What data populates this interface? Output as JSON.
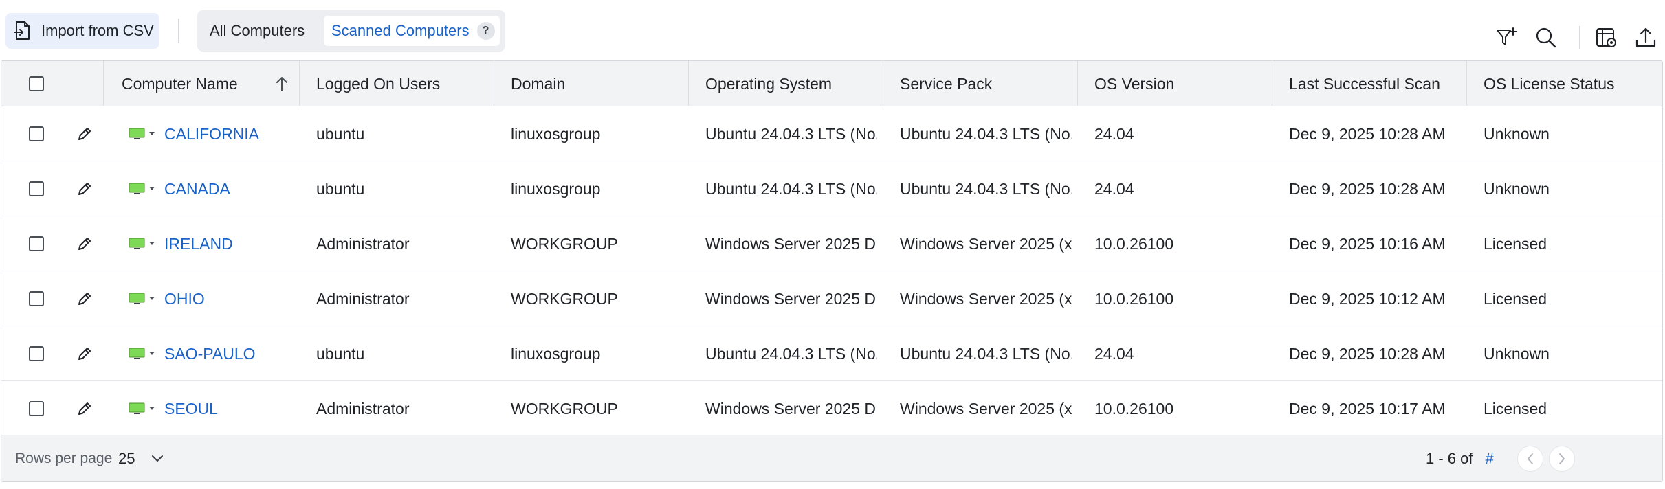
{
  "toolbar": {
    "import_label": "Import from CSV",
    "tabs": [
      {
        "label": "All Computers"
      },
      {
        "label": "Scanned Computers",
        "help": "?"
      }
    ],
    "icons": [
      "filter-add-icon",
      "search-icon",
      "column-settings-icon",
      "export-icon"
    ]
  },
  "colors": {
    "accent": "#1a62c8",
    "computer_icon": "#7ed957",
    "header_bg": "#f2f3f5"
  },
  "table": {
    "headers": [
      "Computer Name",
      "Logged On Users",
      "Domain",
      "Operating System",
      "Service Pack",
      "OS Version",
      "Last Successful Scan",
      "OS License Status"
    ],
    "sort": {
      "column": "Computer Name",
      "direction": "ascending"
    },
    "rows": [
      {
        "name": "CALIFORNIA",
        "user": "ubuntu",
        "domain": "linuxosgroup",
        "os": "Ubuntu 24.04.3 LTS (No...",
        "sp": "Ubuntu 24.04.3 LTS (No...",
        "ver": "24.04",
        "scan": "Dec 9, 2025 10:28 AM",
        "license": "Unknown"
      },
      {
        "name": "CANADA",
        "user": "ubuntu",
        "domain": "linuxosgroup",
        "os": "Ubuntu 24.04.3 LTS (No...",
        "sp": "Ubuntu 24.04.3 LTS (No...",
        "ver": "24.04",
        "scan": "Dec 9, 2025 10:28 AM",
        "license": "Unknown"
      },
      {
        "name": "IRELAND",
        "user": "Administrator",
        "domain": "WORKGROUP",
        "os": "Windows Server 2025 D...",
        "sp": "Windows Server 2025 (x...",
        "ver": "10.0.26100",
        "scan": "Dec 9, 2025 10:16 AM",
        "license": "Licensed"
      },
      {
        "name": "OHIO",
        "user": "Administrator",
        "domain": "WORKGROUP",
        "os": "Windows Server 2025 D...",
        "sp": "Windows Server 2025 (x...",
        "ver": "10.0.26100",
        "scan": "Dec 9, 2025 10:12 AM",
        "license": "Licensed"
      },
      {
        "name": "SAO-PAULO",
        "user": "ubuntu",
        "domain": "linuxosgroup",
        "os": "Ubuntu 24.04.3 LTS (No...",
        "sp": "Ubuntu 24.04.3 LTS (No...",
        "ver": "24.04",
        "scan": "Dec 9, 2025 10:28 AM",
        "license": "Unknown"
      },
      {
        "name": "SEOUL",
        "user": "Administrator",
        "domain": "WORKGROUP",
        "os": "Windows Server 2025 D...",
        "sp": "Windows Server 2025 (x...",
        "ver": "10.0.26100",
        "scan": "Dec 9, 2025 10:17 AM",
        "license": "Licensed"
      }
    ]
  },
  "footer": {
    "rows_per_page_label": "Rows per page",
    "rows_per_page_value": "25",
    "range": "1 - 6 of",
    "total": "#"
  }
}
